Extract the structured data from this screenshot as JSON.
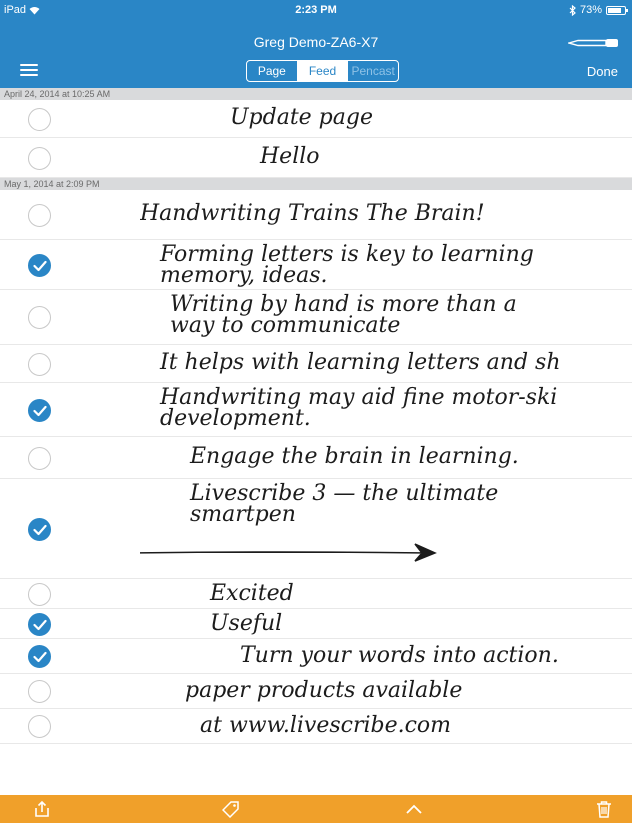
{
  "status_bar": {
    "device": "iPad",
    "time": "2:23 PM",
    "battery": "73%"
  },
  "nav": {
    "title": "Greg Demo-ZA6-X7",
    "done_label": "Done",
    "segments": [
      {
        "label": "Page",
        "state": "normal"
      },
      {
        "label": "Feed",
        "state": "selected"
      },
      {
        "label": "Pencast",
        "state": "disabled"
      }
    ]
  },
  "feed": {
    "sections": [
      {
        "header": "April 24, 2014 at 10:25 AM",
        "rows": [
          {
            "lines": [
              "Update page"
            ],
            "checked": false,
            "height": 38,
            "indent": 90
          },
          {
            "lines": [
              "Hello"
            ],
            "checked": false,
            "height": 40,
            "indent": 120
          }
        ]
      },
      {
        "header": "May 1, 2014 at 2:09 PM",
        "rows": [
          {
            "lines": [
              "Handwriting Trains The Brain!"
            ],
            "checked": false,
            "height": 50,
            "indent": 0
          },
          {
            "lines": [
              "Forming letters is key to learning",
              "memory, ideas."
            ],
            "checked": true,
            "height": 50,
            "indent": 20
          },
          {
            "lines": [
              "Writing by hand is more than a",
              "way to communicate"
            ],
            "checked": false,
            "height": 55,
            "indent": 30
          },
          {
            "lines": [
              "It helps with learning letters and sh"
            ],
            "checked": false,
            "height": 38,
            "indent": 20
          },
          {
            "lines": [
              "Handwriting may aid fine motor-ski",
              "development."
            ],
            "checked": true,
            "height": 54,
            "indent": 20
          },
          {
            "lines": [
              "Engage the brain in learning."
            ],
            "checked": false,
            "height": 42,
            "indent": 50
          },
          {
            "lines": [
              "Livescribe 3 — the ultimate",
              "smartpen"
            ],
            "checked": true,
            "height": 100,
            "indent": 50,
            "arrow": true
          },
          {
            "lines": [
              "Excited"
            ],
            "checked": false,
            "height": 30,
            "indent": 70
          },
          {
            "lines": [
              "Useful"
            ],
            "checked": true,
            "height": 30,
            "indent": 70
          },
          {
            "lines": [
              "Turn your words into action."
            ],
            "checked": true,
            "height": 35,
            "indent": 100
          },
          {
            "lines": [
              "paper products available"
            ],
            "checked": false,
            "height": 35,
            "indent": 45
          },
          {
            "lines": [
              "at www.livescribe.com"
            ],
            "checked": false,
            "height": 35,
            "indent": 60
          }
        ]
      }
    ]
  },
  "toolbar": {
    "icons": [
      "share-icon",
      "tag-icon",
      "chevron-up-icon",
      "trash-icon"
    ]
  },
  "colors": {
    "accent": "#2a86c6",
    "toolbar": "#f0a02a",
    "section_header": "#d9dadc"
  }
}
